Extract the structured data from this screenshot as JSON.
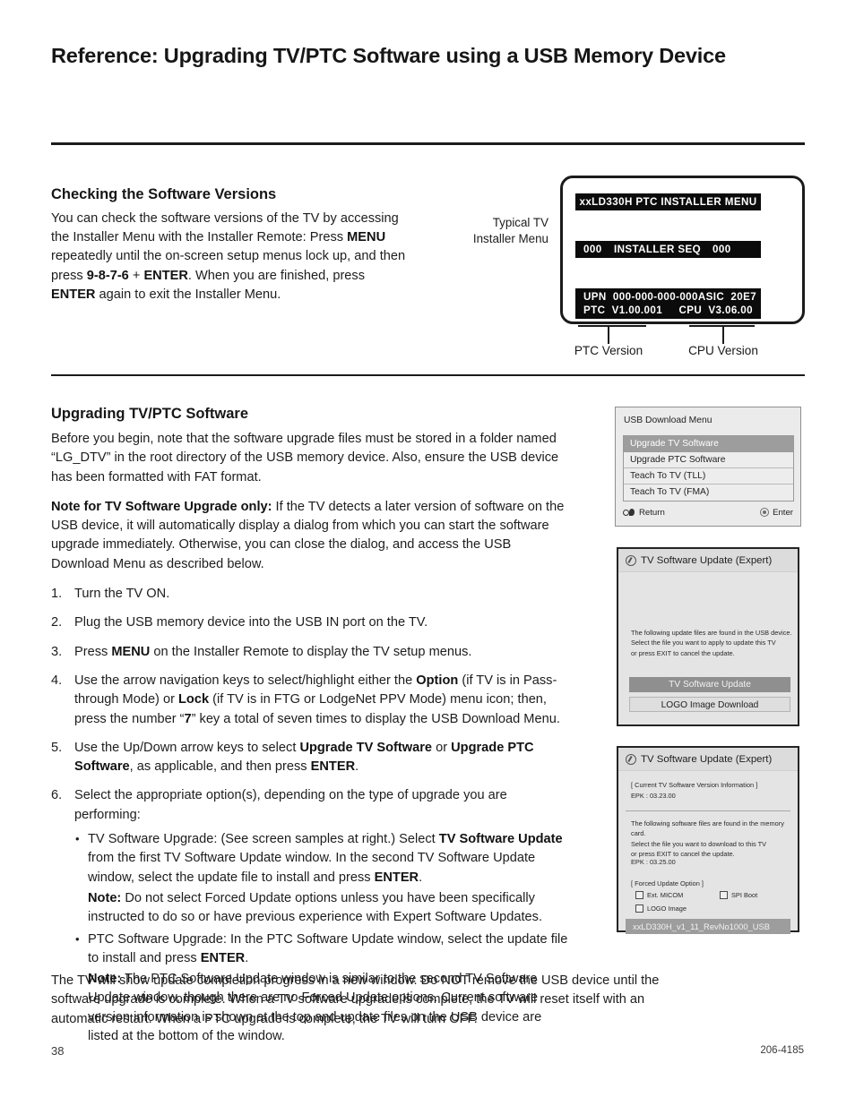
{
  "document": {
    "title": "Reference: Upgrading TV/PTC Software using a USB Memory Device",
    "page_number": "38",
    "doc_code": "206-4185"
  },
  "section_versions": {
    "heading": "Checking the Software Versions",
    "body_html": "You can check the software versions of the TV by accessing the Installer Menu with the Installer Remote: Press <b>MENU</b> repeatedly until the on-screen setup menus lock up, and then press <b>9-8-7-6</b> + <b>ENTER</b>. When you are finished, press <b>ENTER</b> again to exit the Installer Menu.",
    "figure_label": "Typical TV\nInstaller Menu",
    "figure_label_line1": "Typical TV",
    "figure_label_line2": "Installer Menu",
    "callout_ptc": "PTC Version",
    "callout_cpu": "CPU Version",
    "osd": {
      "title": "xxLD330H  PTC  INSTALLER  MENU",
      "seq_number": "000",
      "seq_label": "INSTALLER SEQ",
      "seq_value": "000",
      "upn_left": "UPN  000-000-000-000",
      "asic_right": "ASIC  20E7",
      "ptc_left": "PTC  V1.00.001",
      "cpu_right": "CPU  V3.06.00"
    }
  },
  "section_upgrade": {
    "heading": "Upgrading TV/PTC Software",
    "intro_html": "Before you begin, note that the software upgrade files must be stored in a folder named &ldquo;LG_DTV&rdquo; in the root directory of the USB memory device. Also, ensure the USB device has been formatted with FAT format.",
    "note_html": "<b>Note for TV Software Upgrade only:</b> If the TV detects a later version of software on the USB device, it will automatically display a dialog from which you can start the software upgrade immediately. Otherwise, you can close the dialog, and access the USB Download Menu as described below.",
    "steps": [
      "Turn the TV ON.",
      "Plug the USB memory device into the USB IN port on the TV.",
      "Press <b>MENU</b> on the Installer Remote to display the TV setup menus.",
      "Use the arrow navigation keys to select/highlight either the <b>Option</b> (if TV is in Pass-through Mode) or <b>Lock</b> (if TV is in FTG or LodgeNet PPV Mode) menu icon; then, press the number &ldquo;<b>7</b>&rdquo; key a total of seven times to display the USB Download Menu.",
      "Use the Up/Down arrow keys to select <b>Upgrade TV Software</b> or <b>Upgrade PTC Software</b>, as applicable, and then press <b>ENTER</b>.",
      "Select the appropriate option(s), depending on the type of upgrade you are performing:"
    ],
    "sub_bullets": [
      {
        "text_html": "TV Software Upgrade: (See screen samples at right.) Select <b>TV Software Update</b> from the first TV Software Update window. In the second TV Software Update window, select the update file to install and press <b>ENTER</b>.",
        "note_html": "<b>Note:</b> Do not select Forced Update options unless you have been specifically instructed to do so or have previous experience with Expert Software Updates."
      },
      {
        "text_html": "PTC Software Upgrade: In the PTC Software Update window, select the update file to install and press <b>ENTER</b>.",
        "note_html": "<b>Note:</b> The PTC Software Update window is similar to the second TV Software Update window, though there are no Forced Update options. Current software version information is shown at the top and update files on the USB device are listed at the bottom of the window."
      }
    ],
    "closing_html": "The TV will show update completion progress in a new window. Do NOT remove the USB device until the software upgrade is complete. When a TV software upgrade is complete, the TV will reset itself with an automatic restart. When a PTC upgrade is complete, the TV will turn OFF."
  },
  "usb_download_menu": {
    "title": "USB Download Menu",
    "items": [
      {
        "label": "Upgrade TV Software",
        "selected": true
      },
      {
        "label": "Upgrade PTC Software",
        "selected": false
      },
      {
        "label": "Teach To TV (TLL)",
        "selected": false
      },
      {
        "label": "Teach To TV (FMA)",
        "selected": false
      }
    ],
    "footer_return": "Return",
    "footer_enter": "Enter"
  },
  "expert_window_1": {
    "title": "TV Software Update (Expert)",
    "body_line1": "The following update files are found in the USB device.",
    "body_line2": "Select the file you want to apply to update this TV",
    "body_line3": "or press EXIT to cancel the update.",
    "button_primary": "TV Software Update",
    "button_secondary": "LOGO Image Download"
  },
  "expert_window_2": {
    "title": "TV Software Update (Expert)",
    "version_header": "[ Current TV Software Version Information ]",
    "version_epk": "EPK : 03.23.00",
    "body_line1": "The following software files are found in the memory card.",
    "body_line2": "Select the file you want to download to this TV",
    "body_line3": "or press EXIT to cancel the update.",
    "file_epk": "EPK : 03.25.00",
    "forced_label": "[ Forced Update Option ]",
    "checkbox_micom": "Ext. MICOM",
    "checkbox_spi": "SPI Boot",
    "checkbox_logo": "LOGO Image",
    "file_name": "xxLD330H_v1_11_RevNo1000_USB"
  },
  "colors": {
    "rule": "#1b1b1b",
    "osd_background": "#0b0b0b",
    "osd_text": "#ffffff",
    "selection": "#9d9d9d",
    "panel_background": "#e4e4e4"
  }
}
